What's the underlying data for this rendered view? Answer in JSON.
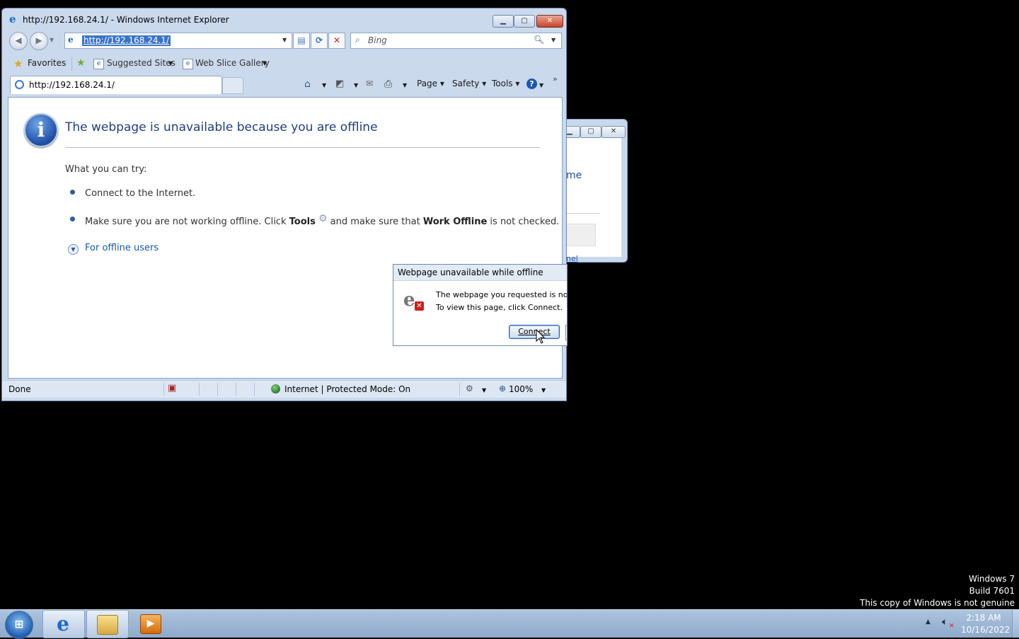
{
  "background_window": {
    "partial_text": "me",
    "partial_link": "nel"
  },
  "ie": {
    "title": "http://192.168.24.1/ - Windows Internet Explorer",
    "address": "http://192.168.24.1/",
    "search_placeholder": "Bing",
    "favorites": {
      "label": "Favorites",
      "items": [
        "Suggested Sites",
        "Web Slice Gallery"
      ]
    },
    "tab_title": "http://192.168.24.1/",
    "commands": {
      "page": "Page",
      "safety": "Safety",
      "tools": "Tools"
    },
    "content": {
      "heading": "The webpage is unavailable because you are offline",
      "try_label": "What you can try:",
      "item1": "Connect to the Internet.",
      "item2_a": "Make sure you are not working offline. Click ",
      "item2_tools": "Tools",
      "item2_b": " and make sure that ",
      "item2_workoffline": "Work Offline",
      "item2_c": " is not checked.",
      "offline_link": "For offline users"
    },
    "status": {
      "text": "Done",
      "zone": "Internet | Protected Mode: On",
      "zoom": "100%"
    }
  },
  "dialog": {
    "title": "Webpage unavailable while offline",
    "msg1": "The webpage you requested is not ava",
    "msg2": "To view this page, click Connect.",
    "connect": "Connect"
  },
  "watermark": [
    "Windows 7",
    "Build 7601",
    "This copy of Windows is not genuine"
  ],
  "taskbar": {
    "time": "2:18 AM",
    "date": "10/16/2022"
  },
  "icons": {
    "ie": "internet-explorer-icon",
    "back": "back-arrow-icon",
    "forward": "forward-arrow-icon",
    "refresh": "refresh-icon",
    "stop": "stop-icon",
    "search": "search-icon",
    "home": "home-icon",
    "feeds": "feeds-icon",
    "mail": "mail-icon",
    "print": "print-icon",
    "help": "help-icon",
    "info": "info-icon",
    "gear": "gear-icon",
    "globe": "globe-icon"
  },
  "colors": {
    "accent": "#3a74c6",
    "heading": "#1f3f7a",
    "link": "#1a56a8",
    "close": "#c8452d"
  }
}
